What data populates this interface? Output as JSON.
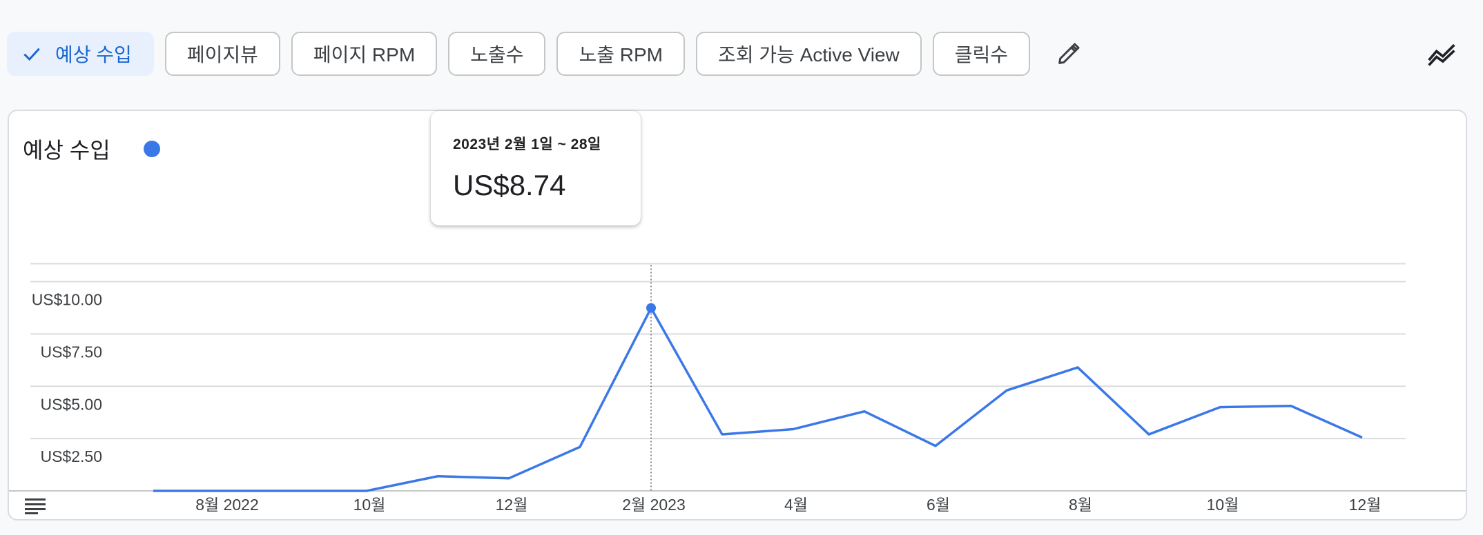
{
  "toolbar": {
    "chips": [
      {
        "label": "예상 수입",
        "selected": true
      },
      {
        "label": "페이지뷰"
      },
      {
        "label": "페이지 RPM"
      },
      {
        "label": "노출수"
      },
      {
        "label": "노출 RPM"
      },
      {
        "label": "조회 가능 Active View"
      },
      {
        "label": "클릭수"
      }
    ],
    "edit_icon": "pencil-icon",
    "trend_icon": "trend-lines-icon"
  },
  "card": {
    "title": "예상 수입",
    "table_icon": "table-view-icon"
  },
  "tooltip": {
    "date": "2023년 2월 1일 ~ 28일",
    "value": "US$8.74"
  },
  "colors": {
    "series": "#3b78e7",
    "accent": "#1967d2",
    "chip_selected_bg": "#e8f0fe"
  },
  "chart_data": {
    "type": "line",
    "title": "예상 수입",
    "ylim": [
      0,
      11
    ],
    "yticks": [
      {
        "value": 2.5,
        "label": "US$2.50"
      },
      {
        "value": 5,
        "label": "US$5.00"
      },
      {
        "value": 7.5,
        "label": "US$7.50"
      },
      {
        "value": 10,
        "label": "US$10.00"
      }
    ],
    "xticks": [
      {
        "index": 1,
        "label": "8월 2022"
      },
      {
        "index": 3,
        "label": "10월"
      },
      {
        "index": 5,
        "label": "12월"
      },
      {
        "index": 7,
        "label": "2월 2023"
      },
      {
        "index": 9,
        "label": "4월"
      },
      {
        "index": 11,
        "label": "6월"
      },
      {
        "index": 13,
        "label": "8월"
      },
      {
        "index": 15,
        "label": "10월"
      },
      {
        "index": 17,
        "label": "12월"
      }
    ],
    "x": [
      "2022-07",
      "2022-08",
      "2022-09",
      "2022-10",
      "2022-11",
      "2022-12",
      "2023-01",
      "2023-02",
      "2023-03",
      "2023-04",
      "2023-05",
      "2023-06",
      "2023-07",
      "2023-08",
      "2023-09",
      "2023-10",
      "2023-11",
      "2023-12"
    ],
    "series": [
      {
        "values": [
          0,
          0,
          0,
          0,
          0.7,
          0.6,
          2.1,
          8.74,
          2.7,
          2.95,
          3.8,
          2.15,
          4.8,
          5.9,
          2.7,
          4.0,
          4.06,
          2.55
        ]
      }
    ],
    "highlight_index": 7,
    "grid": true,
    "legend": "top-left"
  }
}
